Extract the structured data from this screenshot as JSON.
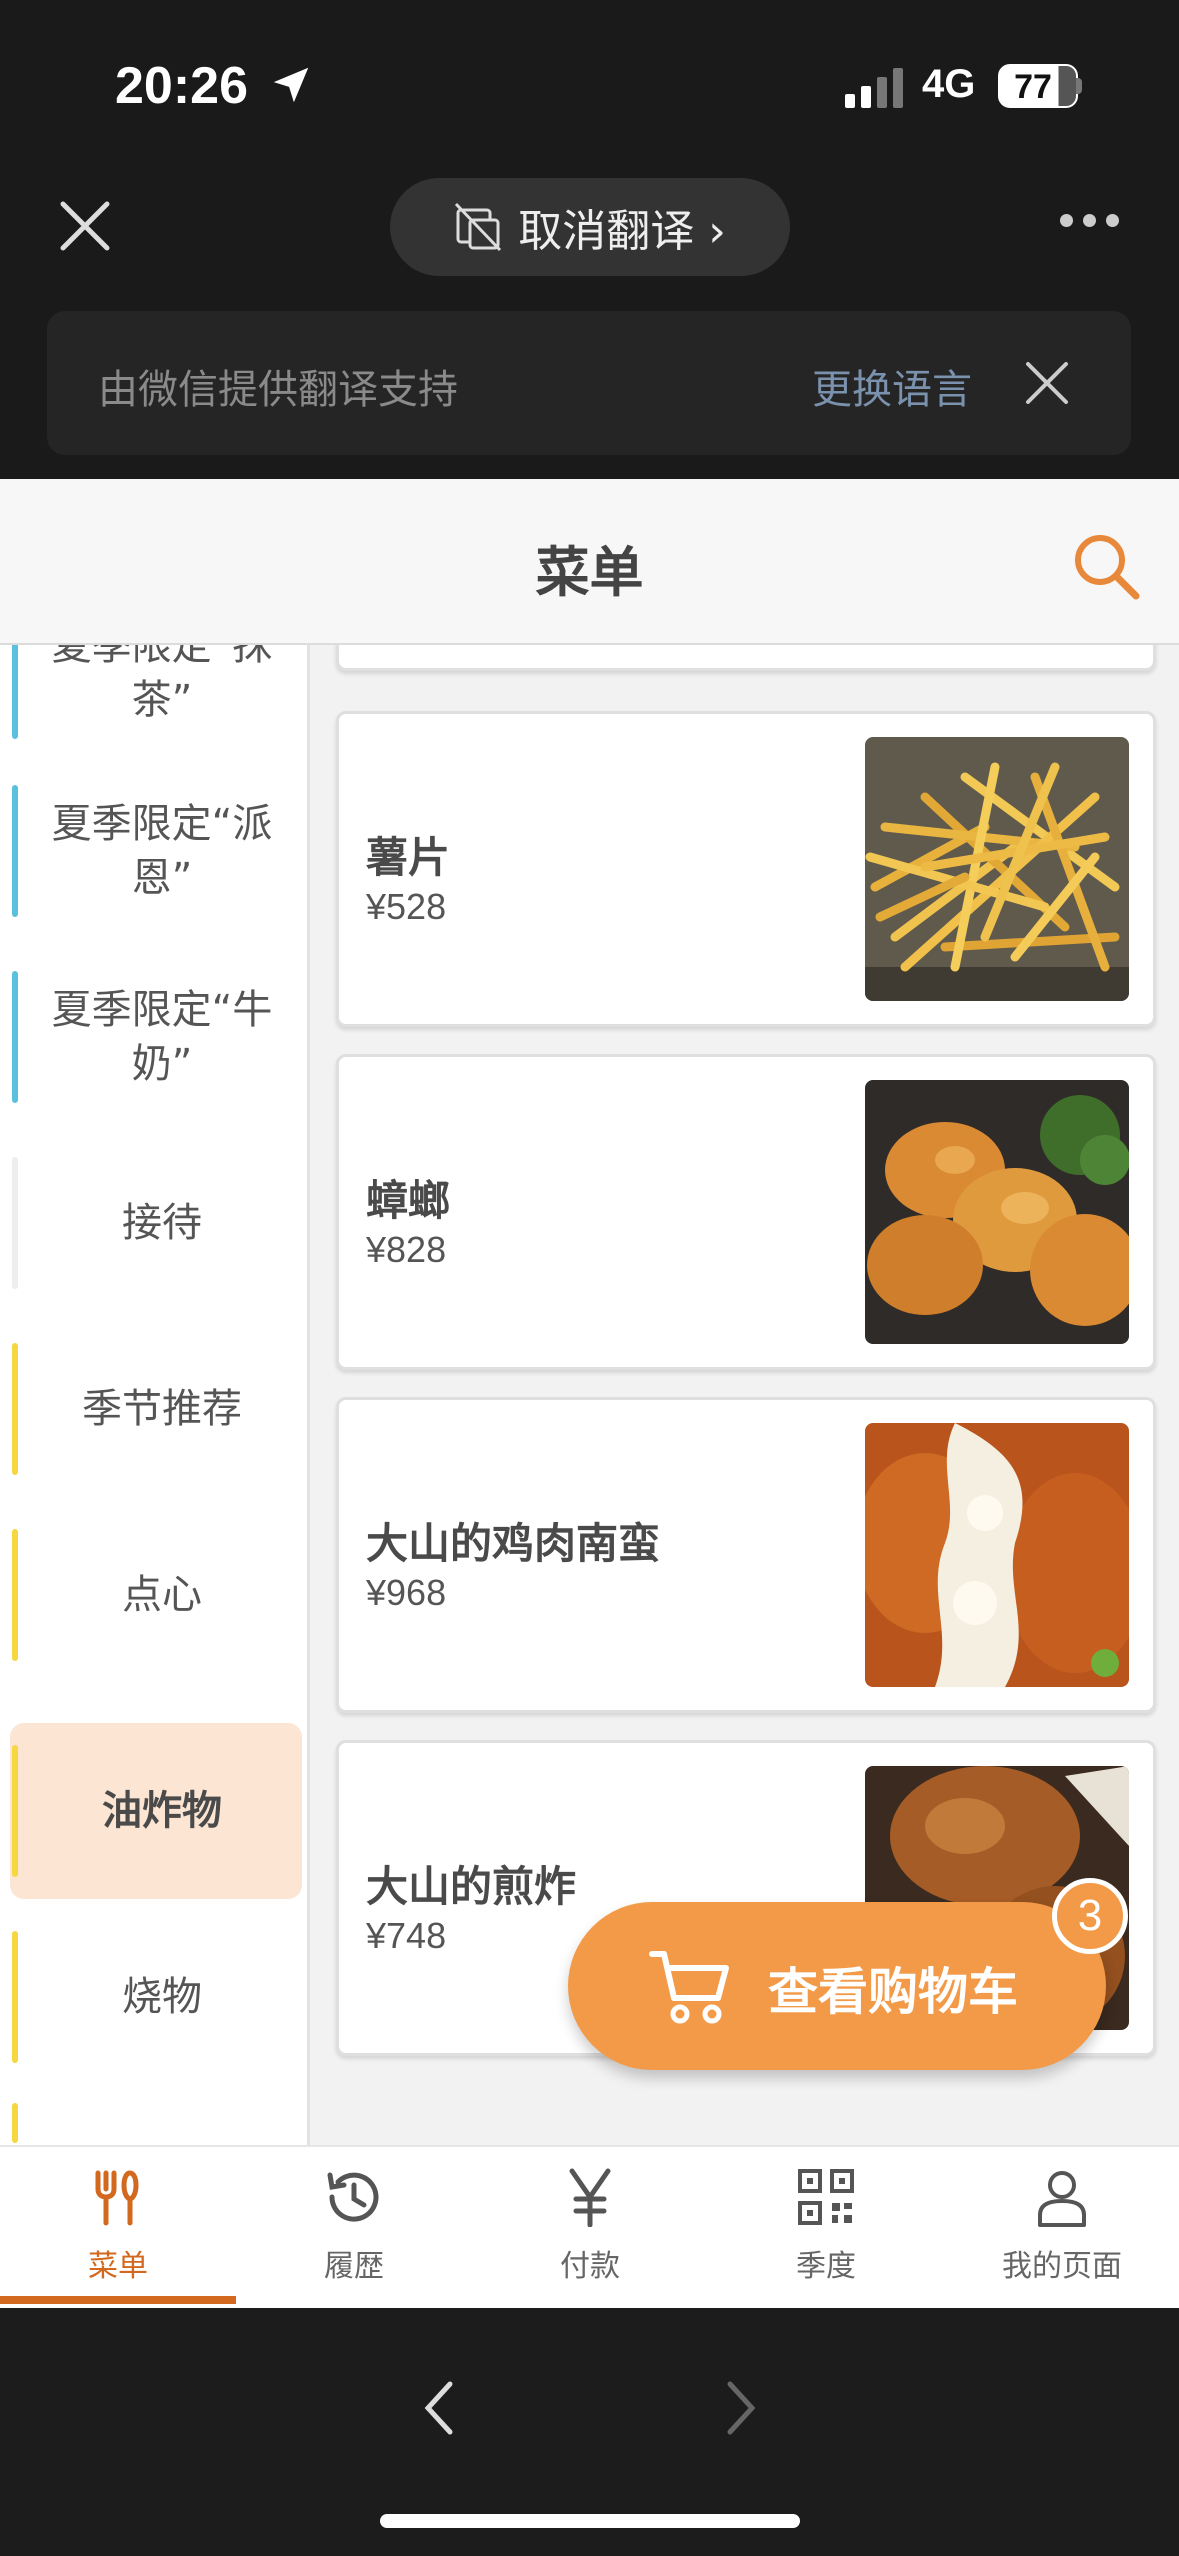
{
  "status_bar": {
    "time": "20:26",
    "network": "4G",
    "battery": "77",
    "battery_level_percent": 77
  },
  "translation_bar": {
    "cancel_label": "取消翻译 ›",
    "banner_text": "由微信提供翻译支持",
    "change_language": "更换语言"
  },
  "header": {
    "title": "菜单"
  },
  "sidebar": {
    "items": [
      {
        "label": "夏季限定“抹茶”",
        "accent": "#5bc0de"
      },
      {
        "label": "夏季限定“派恩”",
        "accent": "#5bc0de"
      },
      {
        "label": "夏季限定“牛奶”",
        "accent": "#5bc0de"
      },
      {
        "label": "接待",
        "accent": "#eeeeee"
      },
      {
        "label": "季节推荐",
        "accent": "#f5d742"
      },
      {
        "label": "点心",
        "accent": "#f5d742"
      },
      {
        "label": "油炸物",
        "accent": "#f5d742",
        "active": true
      },
      {
        "label": "烧物",
        "accent": "#f5d742"
      }
    ]
  },
  "menu_items": [
    {
      "name": "薯片",
      "price": "¥528"
    },
    {
      "name": "蟑螂",
      "price": "¥828"
    },
    {
      "name": "大山的鸡肉南蛮",
      "price": "¥968"
    },
    {
      "name": "大山的煎炸",
      "price": "¥748"
    }
  ],
  "cart": {
    "label": "查看购物车",
    "count": "3"
  },
  "tabbar": {
    "tabs": [
      {
        "label": "菜单",
        "icon": "fork-knife-icon",
        "active": true
      },
      {
        "label": "履歴",
        "icon": "history-icon"
      },
      {
        "label": "付款",
        "icon": "yen-icon"
      },
      {
        "label": "季度",
        "icon": "qr-code-icon"
      },
      {
        "label": "我的页面",
        "icon": "person-icon"
      }
    ]
  },
  "colors": {
    "accent_orange": "#f39a48",
    "active_tab": "#d2691e",
    "active_category_bg": "#fde5d3"
  }
}
